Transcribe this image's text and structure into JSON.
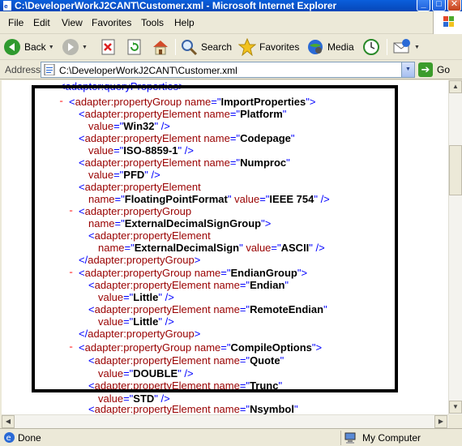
{
  "window": {
    "title": "C:\\DeveloperWorkJ2CANT\\Customer.xml - Microsoft Internet Explorer",
    "min_glyph": "_",
    "max_glyph": "□",
    "close_glyph": "✕"
  },
  "menu": {
    "items": [
      "File",
      "Edit",
      "View",
      "Favorites",
      "Tools",
      "Help"
    ]
  },
  "toolbar": {
    "back": "Back",
    "search": "Search",
    "favorites": "Favorites",
    "media": "Media"
  },
  "address": {
    "label": "Address",
    "value": "C:\\DeveloperWorkJ2CANT\\Customer.xml",
    "go": "Go"
  },
  "xml": {
    "line1": "<adapter:queryProperties>",
    "pg_import": "ImportProperties",
    "pe_platform": "Platform",
    "v_win32": "Win32",
    "pe_codepage": "Codepage",
    "v_iso": "ISO-8859-1",
    "pe_numproc": "Numproc",
    "v_pfd": "PFD",
    "pe_ffp": "FloatingPointFormat",
    "v_ieee": "IEEE 754",
    "pg_eds": "ExternalDecimalSignGroup",
    "pe_eds": "ExternalDecimalSign",
    "v_ascii": "ASCII",
    "pg_endian": "EndianGroup",
    "pe_endian": "Endian",
    "v_little1": "Little",
    "pe_rendian": "RemoteEndian",
    "v_little2": "Little",
    "pg_compile": "CompileOptions",
    "pe_quote": "Quote",
    "v_double": "DOUBLE",
    "pe_trunc": "Trunc",
    "v_std": "STD",
    "pe_nsymbol": "Nsymbol"
  },
  "status": {
    "left": "Done",
    "zone": "My Computer"
  },
  "colors": {
    "tag": "#990000",
    "markup": "#0000ff",
    "title_bar": "#0a5fdc"
  }
}
